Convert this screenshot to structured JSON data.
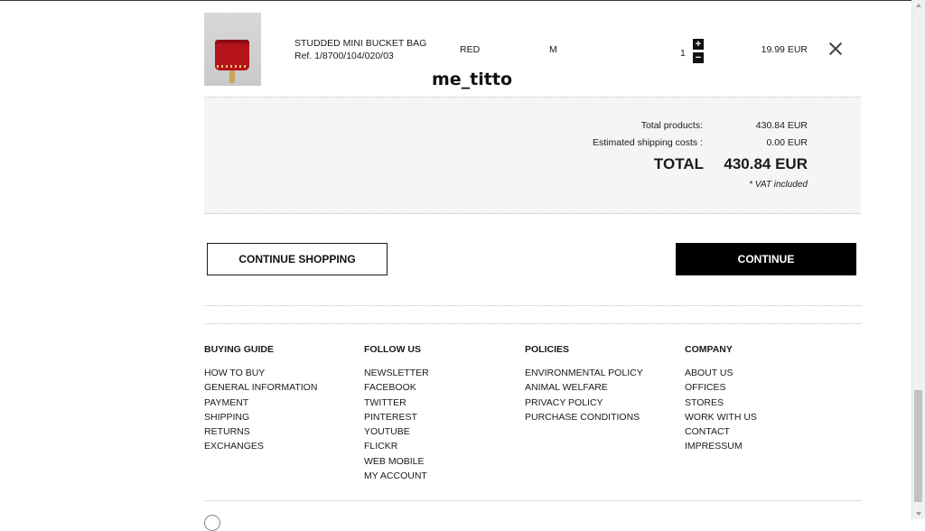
{
  "cart_item": {
    "name": "STUDDED MINI BUCKET BAG",
    "ref": "Ref. 1/8700/104/020/03",
    "color": "RED",
    "size": "M",
    "quantity": "1",
    "qty_increase_icon": "+",
    "qty_decrease_icon": "−",
    "price": "19.99 EUR",
    "remove_icon": "close-x"
  },
  "overlay_text": "me_titto",
  "summary": {
    "total_products_label": "Total products:",
    "total_products_value": "430.84 EUR",
    "shipping_label": "Estimated shipping costs :",
    "shipping_value": "0.00 EUR",
    "total_label": "TOTAL",
    "total_value": "430.84 EUR",
    "vat_note": "* VAT included"
  },
  "buttons": {
    "continue_shopping": "CONTINUE SHOPPING",
    "continue": "CONTINUE"
  },
  "footer": {
    "columns": [
      {
        "heading": "BUYING GUIDE",
        "links": [
          "HOW TO BUY",
          "GENERAL INFORMATION",
          "PAYMENT",
          "SHIPPING",
          "RETURNS",
          "EXCHANGES"
        ]
      },
      {
        "heading": "FOLLOW US",
        "links": [
          "NEWSLETTER",
          "FACEBOOK",
          "TWITTER",
          "PINTEREST",
          "YOUTUBE",
          "FLICKR",
          "WEB MOBILE",
          "MY ACCOUNT"
        ]
      },
      {
        "heading": "POLICIES",
        "links": [
          "ENVIRONMENTAL POLICY",
          "ANIMAL WELFARE",
          "PRIVACY POLICY",
          "PURCHASE CONDITIONS"
        ]
      },
      {
        "heading": "COMPANY",
        "links": [
          "ABOUT US",
          "OFFICES",
          "STORES",
          "WORK WITH US",
          "CONTACT",
          "IMPRESSUM"
        ]
      }
    ]
  },
  "colors": {
    "background": "#ffffff",
    "summary_background": "#f5f5f5",
    "primary_button": "#000000",
    "text": "#1a1a1a"
  }
}
